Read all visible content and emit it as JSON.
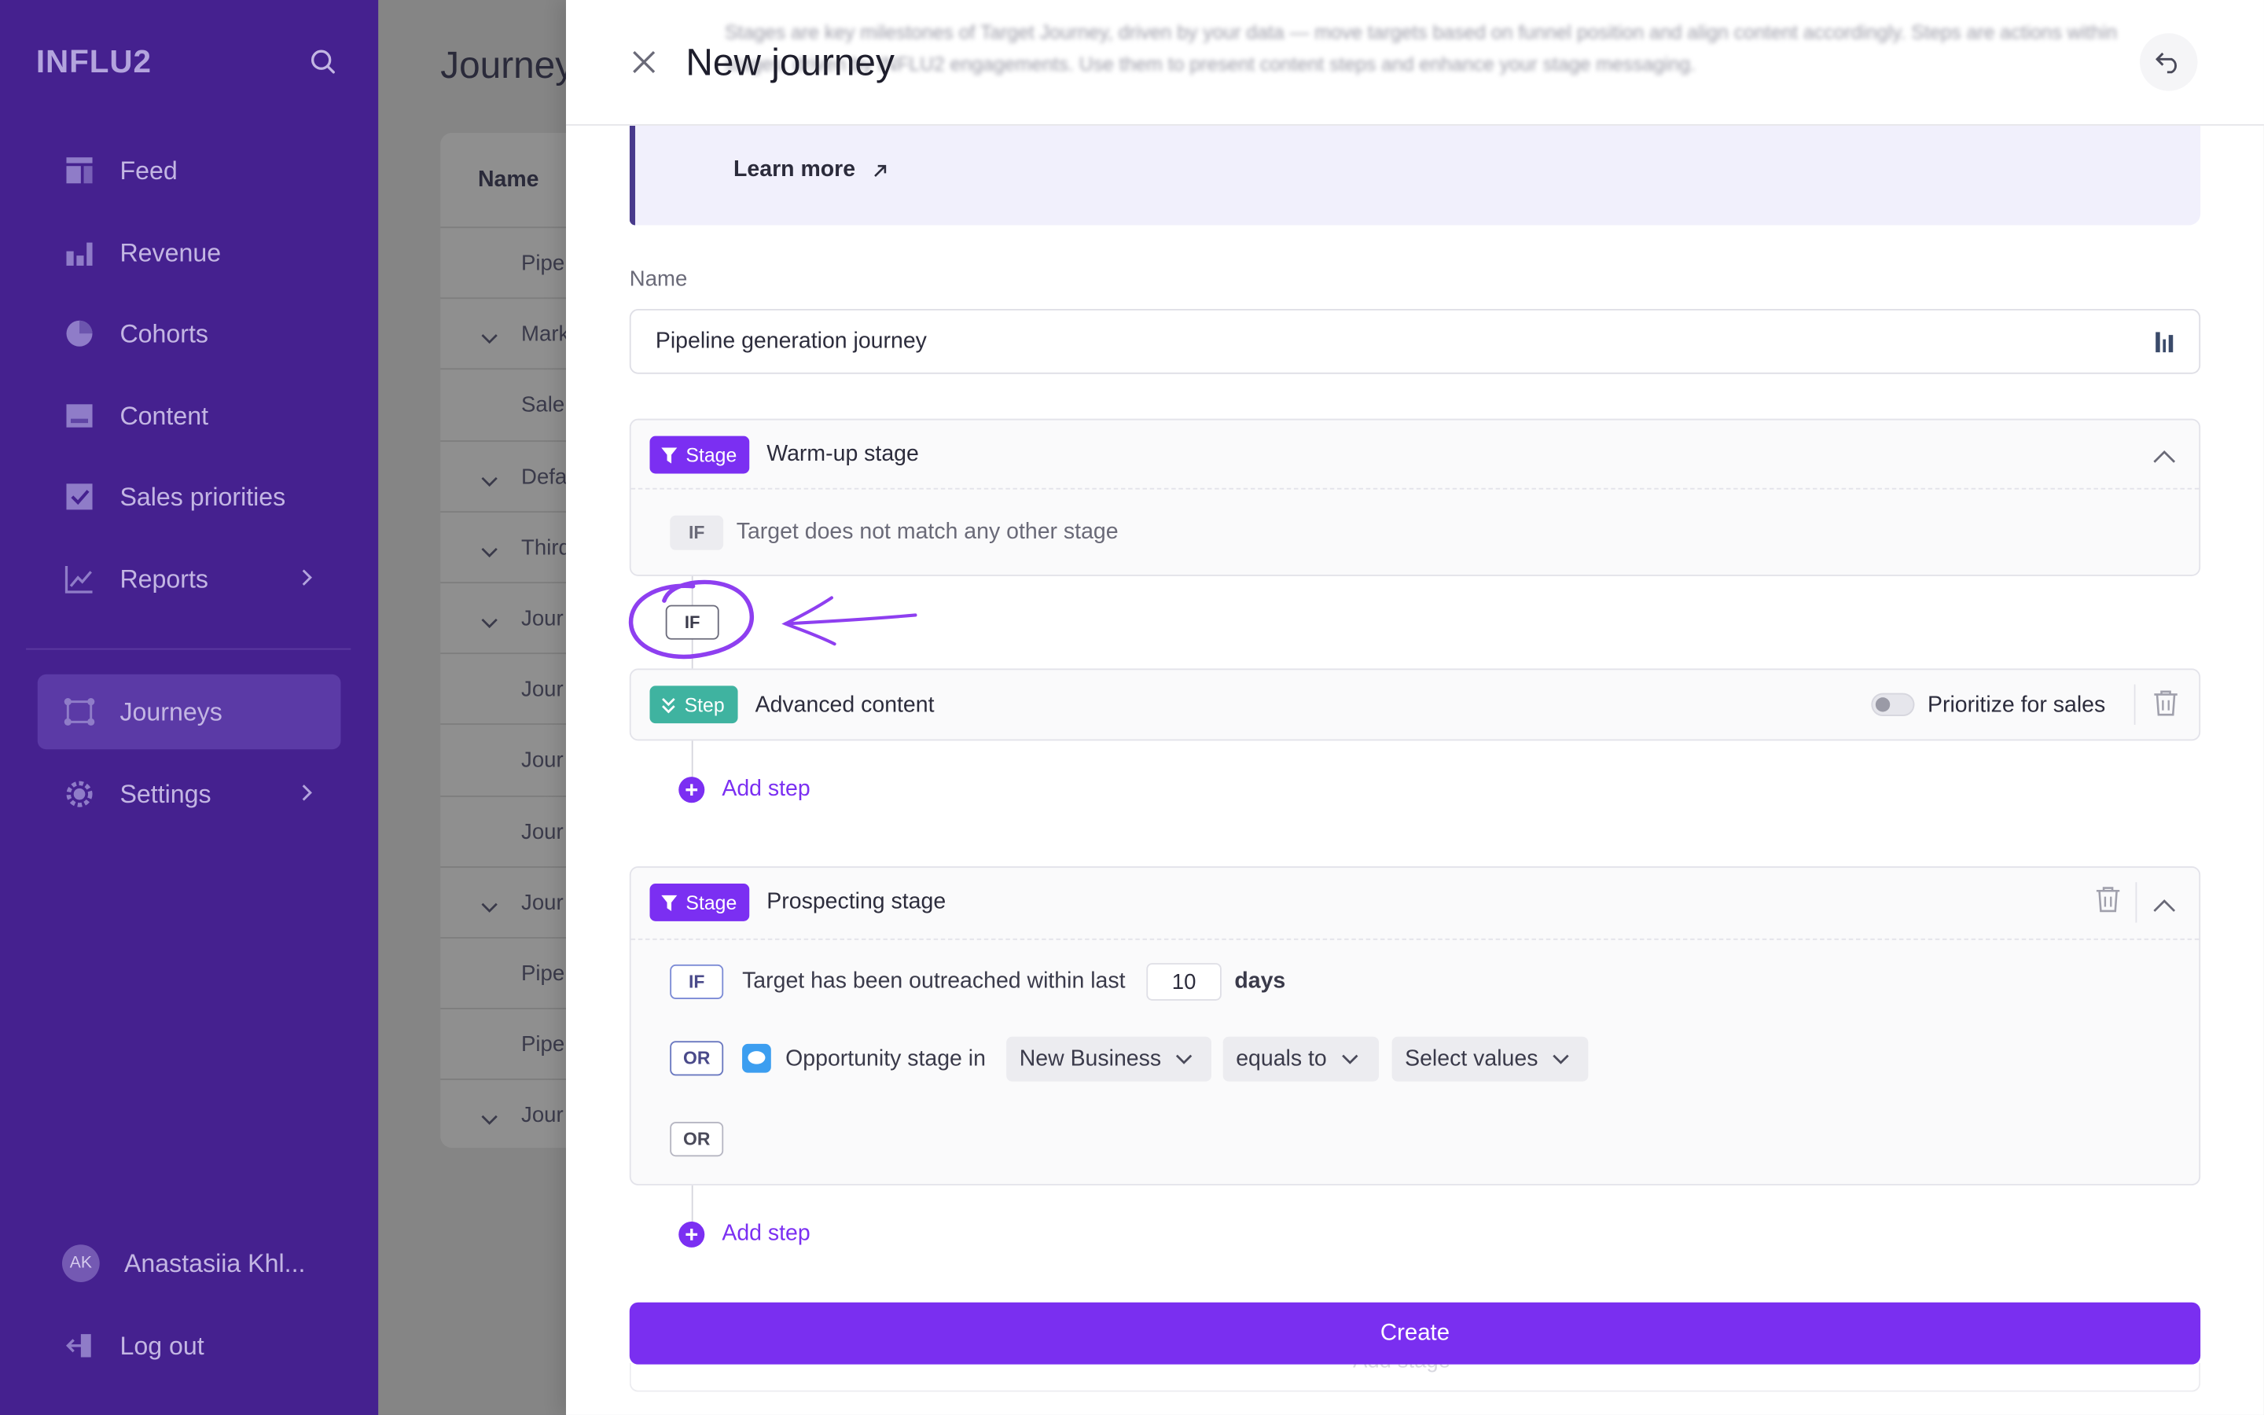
{
  "sidebar": {
    "logo": "INFLU2",
    "items": [
      {
        "label": "Feed",
        "icon": "feed-icon"
      },
      {
        "label": "Revenue",
        "icon": "bar-chart-icon"
      },
      {
        "label": "Cohorts",
        "icon": "pie-chart-icon"
      },
      {
        "label": "Content",
        "icon": "content-icon"
      },
      {
        "label": "Sales priorities",
        "icon": "checkbox-icon"
      },
      {
        "label": "Reports",
        "icon": "line-chart-icon",
        "has_submenu": true
      },
      {
        "label": "Journeys",
        "icon": "journeys-icon",
        "active": true
      },
      {
        "label": "Settings",
        "icon": "gear-icon",
        "has_submenu": true
      }
    ],
    "user": {
      "initials": "AK",
      "name": "Anastasiia Khl..."
    },
    "logout": "Log out"
  },
  "background": {
    "title": "Journey",
    "column_header": "Name",
    "rows": [
      {
        "text": "Pipe",
        "expandable": false
      },
      {
        "text": "Mark",
        "expandable": true
      },
      {
        "text": "Sale",
        "expandable": false
      },
      {
        "text": "Defa",
        "expandable": true
      },
      {
        "text": "Third",
        "expandable": true
      },
      {
        "text": "Jour",
        "expandable": true
      },
      {
        "text": "Jour",
        "expandable": false
      },
      {
        "text": "Jour",
        "expandable": false
      },
      {
        "text": "Jour",
        "expandable": false
      },
      {
        "text": "Jour",
        "expandable": true
      },
      {
        "text": "Pipe",
        "expandable": false
      },
      {
        "text": "Pipe",
        "expandable": false
      },
      {
        "text": "Jour",
        "expandable": true
      }
    ]
  },
  "drawer": {
    "title": "New journey",
    "info_text": "Stages are key milestones of Target Journey, driven by your data — move targets based on funnel position and align content accordingly. Steps are actions within stages, driven by INFLU2 engagements. Use them to present content steps and enhance your stage messaging.",
    "learn_more": "Learn more",
    "name_label": "Name",
    "name_value": "Pipeline generation journey",
    "stage1": {
      "badge": "Stage",
      "title": "Warm-up stage",
      "if_label": "IF",
      "condition": "Target does not match any other stage"
    },
    "annotation_if": "IF",
    "step1": {
      "badge": "Step",
      "title": "Advanced content",
      "toggle_label": "Prioritize for sales",
      "toggle_on": false
    },
    "add_step": "Add step",
    "stage2": {
      "badge": "Stage",
      "title": "Prospecting stage",
      "if_label": "IF",
      "cond1_text": "Target has been outreached within last",
      "cond1_value": "10",
      "cond1_unit": "days",
      "or_label": "OR",
      "cond2_text": "Opportunity stage in",
      "cond2_select1": "New Business",
      "cond2_select2": "equals to",
      "cond2_select3": "Select values",
      "or_label2": "OR"
    },
    "add_step2": "Add step",
    "create_button": "Create",
    "add_stage_ghost": "Add stage"
  },
  "colors": {
    "sidebar_bg": "#45218f",
    "accent": "#7b2ff2",
    "step_badge": "#3fb3a0",
    "annotation": "#8e3ff0"
  }
}
